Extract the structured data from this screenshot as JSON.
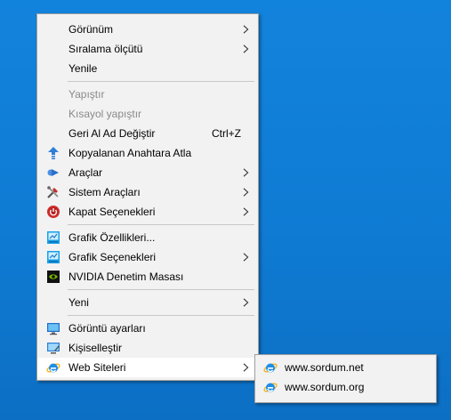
{
  "desktop": {
    "background": "#0f7fd8"
  },
  "context_menu": {
    "groups": [
      [
        {
          "label": "Görünüm",
          "submenu": true
        },
        {
          "label": "Sıralama ölçütü",
          "submenu": true
        },
        {
          "label": "Yenile"
        }
      ],
      [
        {
          "label": "Yapıştır",
          "disabled": true
        },
        {
          "label": "Kısayol yapıştır",
          "disabled": true
        },
        {
          "label": "Geri Al Ad Değiştir",
          "shortcut": "Ctrl+Z"
        },
        {
          "label": "Kopyalanan Anahtara Atla",
          "icon": "pin-icon"
        },
        {
          "label": "Araçlar",
          "icon": "tools-arrow-icon",
          "submenu": true
        },
        {
          "label": "Sistem Araçları",
          "icon": "system-tools-icon",
          "submenu": true
        },
        {
          "label": "Kapat Seçenekleri",
          "icon": "power-icon",
          "submenu": true
        }
      ],
      [
        {
          "label": "Grafik Özellikleri...",
          "icon": "intel-graphics-icon"
        },
        {
          "label": "Grafik Seçenekleri",
          "icon": "intel-graphics-icon",
          "submenu": true
        },
        {
          "label": "NVIDIA Denetim Masası",
          "icon": "nvidia-icon"
        }
      ],
      [
        {
          "label": "Yeni",
          "submenu": true
        }
      ],
      [
        {
          "label": "Görüntü ayarları",
          "icon": "display-icon"
        },
        {
          "label": "Kişiselleştir",
          "icon": "personalize-icon"
        },
        {
          "label": "Web Siteleri",
          "icon": "internet-explorer-icon",
          "submenu": true,
          "highlighted": true
        }
      ]
    ]
  },
  "submenu": {
    "items": [
      {
        "label": "www.sordum.net",
        "icon": "internet-explorer-icon"
      },
      {
        "label": "www.sordum.org",
        "icon": "internet-explorer-icon"
      }
    ]
  }
}
